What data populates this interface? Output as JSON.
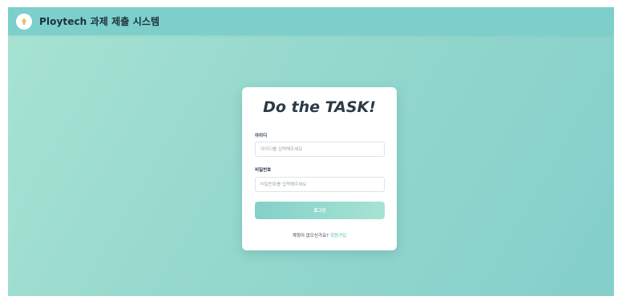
{
  "header": {
    "title": "Ploytech 과제 제출 시스템",
    "logo_icon": "lightbulb-icon",
    "background_color": "#7ccfcb"
  },
  "login_card": {
    "title": "Do the TASK!",
    "id_field": {
      "label": "아이디",
      "placeholder": "아이디를 입력해주세요",
      "value": ""
    },
    "password_field": {
      "label": "비밀번호",
      "placeholder": "비밀번호를 입력해주세요",
      "value": ""
    },
    "login_button_label": "로그인",
    "signup_prompt": "계정이 없으신가요?",
    "signup_link_label": "회원가입"
  },
  "colors": {
    "accent": "#84d0ca",
    "link": "#55b8b4",
    "title_text": "#2b3a48"
  }
}
